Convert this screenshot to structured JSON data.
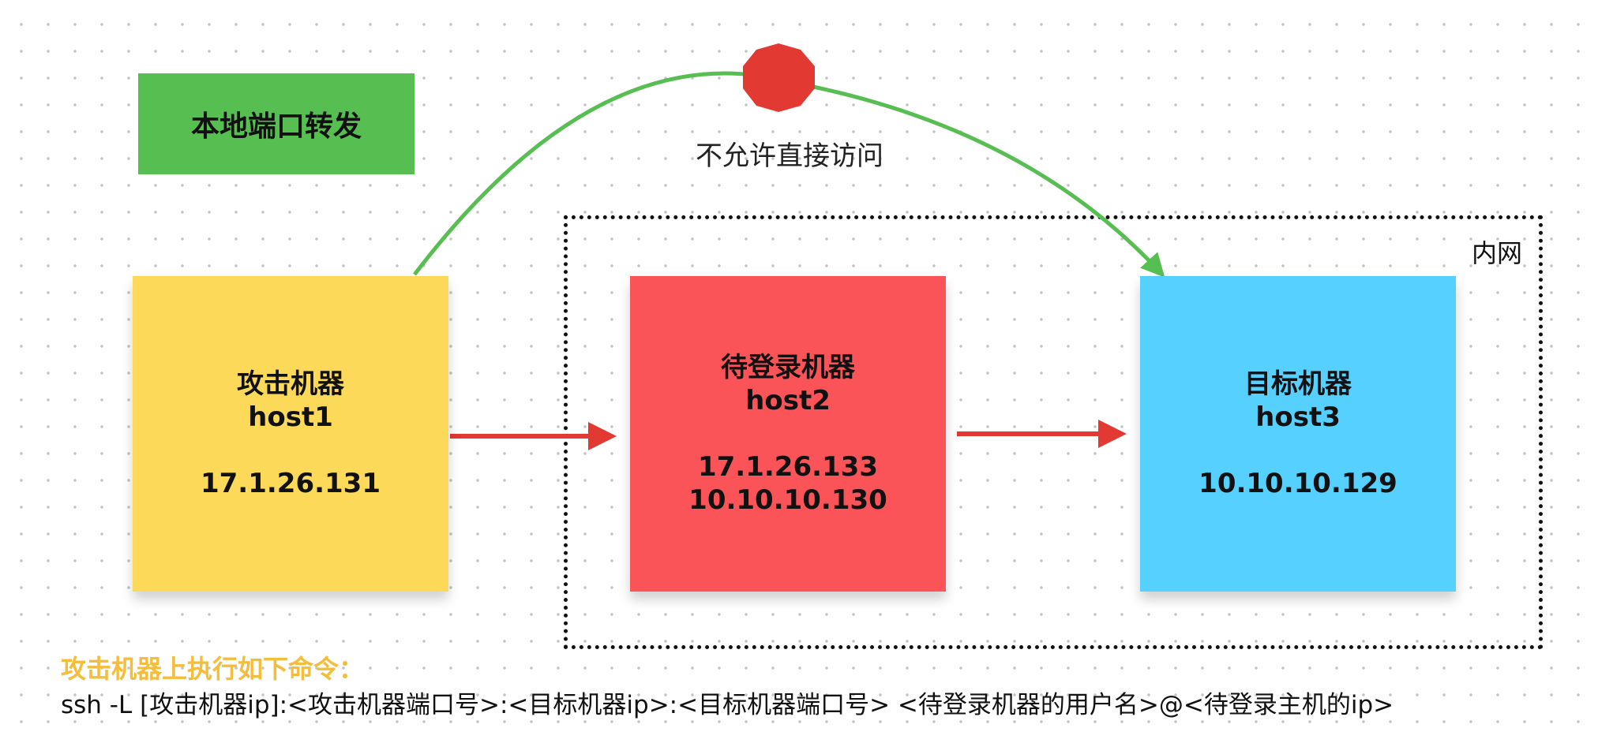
{
  "colors": {
    "title_box": "#57be52",
    "attacker": "#fdd959",
    "jump": "#fa5358",
    "target": "#56d0fe",
    "arrow_red": "#e23933",
    "arrow_green": "#57be52",
    "stop_sign": "#e23933",
    "heading_text": "#f4bd3b"
  },
  "title": "本地端口转发",
  "forbidden_label": "不允许直接访问",
  "intranet_label": "内网",
  "nodes": [
    {
      "name": "攻击机器",
      "host": "host1",
      "ips": [
        "17.1.26.131"
      ]
    },
    {
      "name": "待登录机器",
      "host": "host2",
      "ips": [
        "17.1.26.133",
        "10.10.10.130"
      ]
    },
    {
      "name": "目标机器",
      "host": "host3",
      "ips": [
        "10.10.10.129"
      ]
    }
  ],
  "command": {
    "heading": "攻击机器上执行如下命令：",
    "text": "ssh -L [攻击机器ip]:<攻击机器端口号>:<目标机器ip>:<目标机器端口号> <待登录机器的用户名>@<待登录主机的ip>"
  }
}
